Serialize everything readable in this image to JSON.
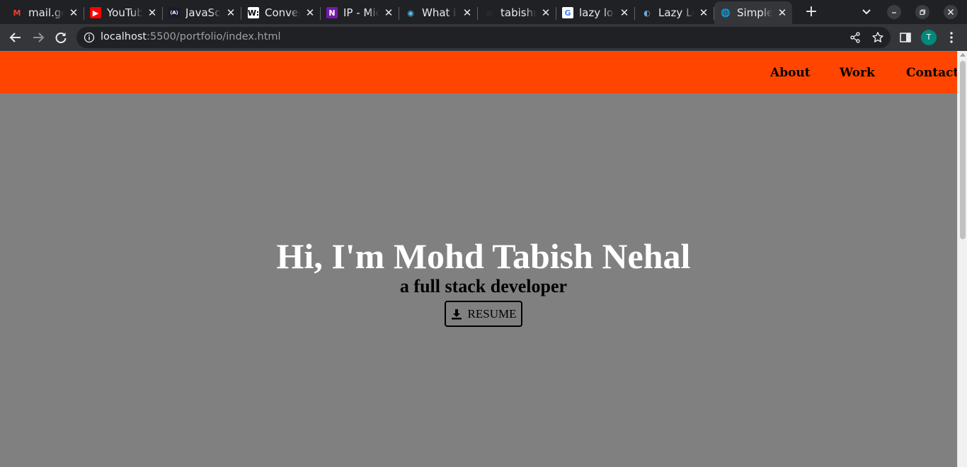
{
  "browser": {
    "tabs": [
      {
        "title": "mail.google.com",
        "icon": "gmail-icon",
        "fav_text": "M",
        "fav_color": "#ea4335",
        "fav_bg": "transparent"
      },
      {
        "title": "YouTube",
        "icon": "youtube-icon",
        "fav_text": "▶",
        "fav_color": "#ffffff",
        "fav_bg": "#ff0000"
      },
      {
        "title": "JavaScript",
        "icon": "javascript-site-icon",
        "fav_text": "⟨A⟩",
        "fav_color": "#ffffff",
        "fav_bg": "#1a1a2e"
      },
      {
        "title": "Convert",
        "icon": "w3-icon",
        "fav_text": "W:",
        "fav_color": "#000000",
        "fav_bg": "#ffffff"
      },
      {
        "title": "IP - Microsoft OneNote",
        "icon": "onenote-icon",
        "fav_text": "N",
        "fav_color": "#ffffff",
        "fav_bg": "#7719aa"
      },
      {
        "title": "What is",
        "icon": "edge-icon",
        "fav_text": "◉",
        "fav_color": "#4fc3f7",
        "fav_bg": "transparent"
      },
      {
        "title": "tabishnehal",
        "icon": "github-icon",
        "fav_text": "●",
        "fav_color": "#24292e",
        "fav_bg": "transparent"
      },
      {
        "title": "lazy loading",
        "icon": "google-icon",
        "fav_text": "G",
        "fav_color": "#4285f4",
        "fav_bg": "#ffffff"
      },
      {
        "title": "Lazy Loading",
        "icon": "globe-image-icon",
        "fav_text": "◐",
        "fav_color": "#6fa8dc",
        "fav_bg": "transparent"
      },
      {
        "title": "Simple",
        "icon": "globe-icon",
        "fav_text": "🌐",
        "fav_color": "#e8eaed",
        "fav_bg": "transparent",
        "active": true
      }
    ],
    "url_host": "localhost",
    "url_rest": ":5500/portfolio/index.html",
    "profile_initial": "T"
  },
  "page": {
    "nav": {
      "about": "About",
      "work": "Work",
      "contact": "Contact"
    },
    "hero": {
      "title": "Hi, I'm Mohd Tabish Nehal",
      "subtitle": "a full stack developer",
      "resume_label": "RESUME"
    },
    "colors": {
      "nav_bg": "#ff4500",
      "page_bg": "#808080",
      "title_color": "#ffffff"
    }
  }
}
